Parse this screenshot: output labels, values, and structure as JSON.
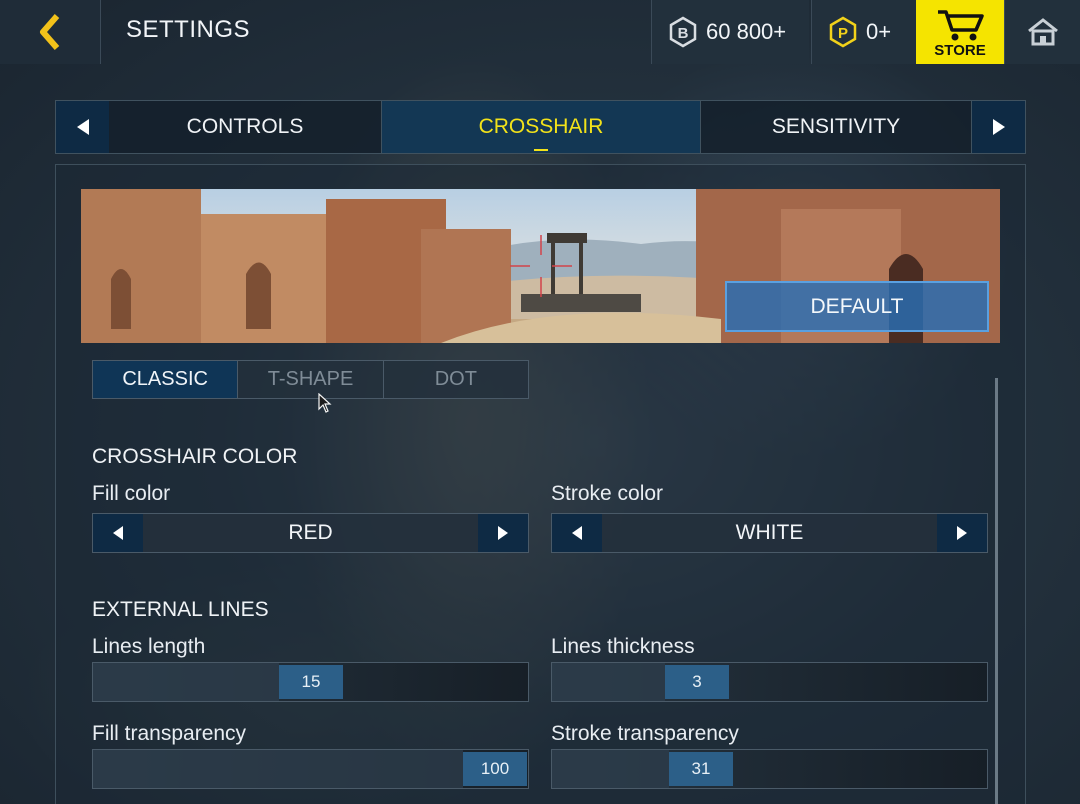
{
  "header": {
    "title": "SETTINGS",
    "currency_b": "60 800+",
    "currency_p": "0+",
    "store_label": "STORE"
  },
  "tabs": {
    "items": [
      {
        "label": "CONTROLS",
        "active": false
      },
      {
        "label": "CROSSHAIR",
        "active": true
      },
      {
        "label": "SENSITIVITY",
        "active": false
      }
    ]
  },
  "preview": {
    "default_label": "DEFAULT"
  },
  "crosshair_style": {
    "options": [
      "CLASSIC",
      "T-SHAPE",
      "DOT"
    ],
    "selected": "CLASSIC"
  },
  "color_section": {
    "title": "CROSSHAIR COLOR",
    "fill_label": "Fill color",
    "fill_value": "RED",
    "stroke_label": "Stroke color",
    "stroke_value": "WHITE"
  },
  "lines_section": {
    "title": "EXTERNAL LINES",
    "length_label": "Lines length",
    "length_value": "15",
    "thickness_label": "Lines thickness",
    "thickness_value": "3",
    "fill_transparency_label": "Fill transparency",
    "fill_transparency_value": "100",
    "stroke_transparency_label": "Stroke transparency",
    "stroke_transparency_value": "31"
  },
  "colors": {
    "accent_yellow": "#f2e21a",
    "store_yellow": "#f5e400",
    "active_blue": "#0f3556",
    "thumb_blue": "#2c5f88"
  }
}
